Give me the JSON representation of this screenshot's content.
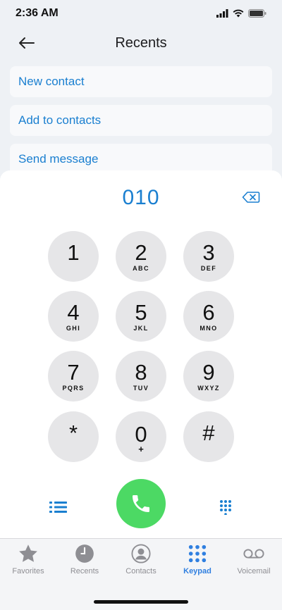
{
  "status_bar": {
    "time": "2:36 AM"
  },
  "header": {
    "title": "Recents"
  },
  "menu": [
    {
      "label": "New contact"
    },
    {
      "label": "Add to contacts"
    },
    {
      "label": "Send message"
    }
  ],
  "dialer": {
    "number": "010",
    "keys": [
      {
        "digit": "1",
        "letters": ""
      },
      {
        "digit": "2",
        "letters": "ABC"
      },
      {
        "digit": "3",
        "letters": "DEF"
      },
      {
        "digit": "4",
        "letters": "GHI"
      },
      {
        "digit": "5",
        "letters": "JKL"
      },
      {
        "digit": "6",
        "letters": "MNO"
      },
      {
        "digit": "7",
        "letters": "PQRS"
      },
      {
        "digit": "8",
        "letters": "TUV"
      },
      {
        "digit": "9",
        "letters": "WXYZ"
      },
      {
        "digit": "*",
        "letters": ""
      },
      {
        "digit": "0",
        "letters": "+"
      },
      {
        "digit": "#",
        "letters": ""
      }
    ]
  },
  "tabs": [
    {
      "label": "Favorites",
      "icon": "star-icon"
    },
    {
      "label": "Recents",
      "icon": "clock-icon"
    },
    {
      "label": "Contacts",
      "icon": "person-icon"
    },
    {
      "label": "Keypad",
      "icon": "keypad-icon",
      "active": true
    },
    {
      "label": "Voicemail",
      "icon": "voicemail-icon"
    }
  ],
  "colors": {
    "accent": "#1a7fd0",
    "call": "#4cd964",
    "tab_active": "#2f7fe0",
    "tab_inactive": "#8e8e93"
  }
}
